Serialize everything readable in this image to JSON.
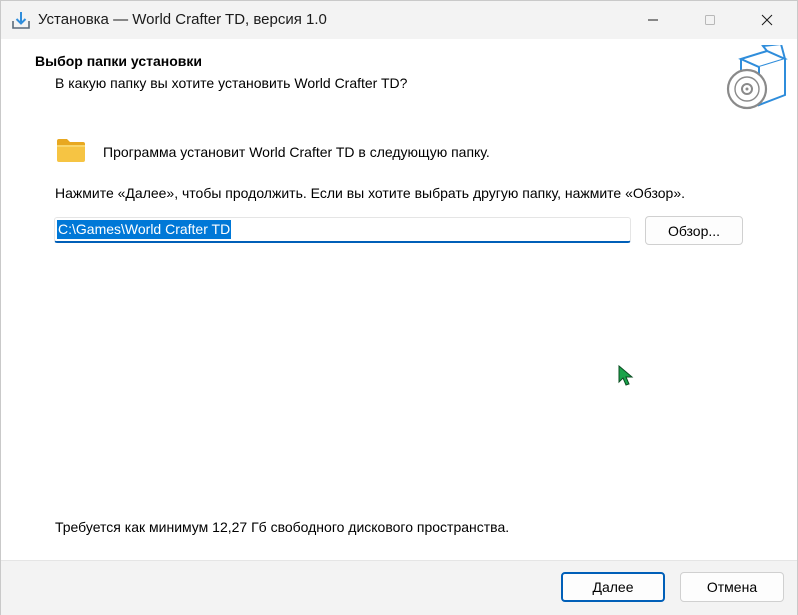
{
  "window": {
    "title": "Установка — World Crafter TD, версия 1.0",
    "icons": [
      "installer-icon",
      "minimize-icon",
      "maximize-icon",
      "close-icon"
    ]
  },
  "header": {
    "title": "Выбор папки установки",
    "subtitle": "В какую папку вы хотите установить World Crafter TD?",
    "icon": "install-box-disc-icon"
  },
  "content": {
    "info_line": "Программа установит World Crafter TD в следующую папку.",
    "instruction": "Нажмите «Далее», чтобы продолжить. Если вы хотите выбрать другую папку, нажмите «Обзор».",
    "path_value": "C:\\Games\\World Crafter TD",
    "browse_label": "Обзор...",
    "disk_space": "Требуется как минимум 12,27 Гб свободного дискового пространства.",
    "folder_icon": "folder-icon"
  },
  "footer": {
    "next_label": "Далее",
    "cancel_label": "Отмена"
  },
  "colors": {
    "accent": "#005fb8",
    "selection": "#0078d7",
    "chrome_bg": "#f3f3f3",
    "panel_bg": "#ffffff",
    "folder_yellow": "#f6c443",
    "box_blue": "#2f8ddb"
  }
}
